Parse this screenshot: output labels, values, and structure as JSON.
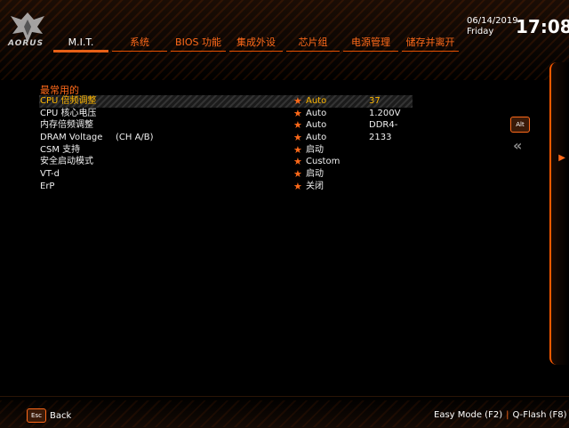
{
  "header": {
    "logo_text": "AORUS",
    "date": "06/14/2019",
    "day": "Friday",
    "time": "17:08"
  },
  "tabs": [
    {
      "label": "M.I.T."
    },
    {
      "label": "系统"
    },
    {
      "label": "BIOS 功能"
    },
    {
      "label": "集成外设"
    },
    {
      "label": "芯片组"
    },
    {
      "label": "电源管理"
    },
    {
      "label": "储存并离开"
    }
  ],
  "main": {
    "section_title": "最常用的",
    "rows": [
      {
        "label": "CPU 倍频调整",
        "sub": "",
        "value": "Auto",
        "current": "37"
      },
      {
        "label": "CPU 核心电压",
        "sub": "",
        "value": "Auto",
        "current": "1.200V"
      },
      {
        "label": "内存倍频调整",
        "sub": "",
        "value": "Auto",
        "current": "DDR4-2133"
      },
      {
        "label": "DRAM Voltage",
        "sub": "(CH A/B)",
        "value": "Auto",
        "current": ""
      },
      {
        "label": "CSM 支持",
        "sub": "",
        "value": "启动",
        "current": ""
      },
      {
        "label": "安全启动模式",
        "sub": "",
        "value": "Custom",
        "current": ""
      },
      {
        "label": "VT-d",
        "sub": "",
        "value": "启动",
        "current": ""
      },
      {
        "label": "ErP",
        "sub": "",
        "value": "关闭",
        "current": ""
      }
    ]
  },
  "side": {
    "alt_label": "Alt",
    "chevron": "«"
  },
  "footer": {
    "esc_label": "Esc",
    "back_label": "Back",
    "easy_mode": "Easy Mode (F2)",
    "separator": "|",
    "qflash": "Q-Flash (F8)"
  },
  "colors": {
    "accent": "#ff6a1a",
    "selected_text": "#ffb700",
    "background": "#000000"
  }
}
